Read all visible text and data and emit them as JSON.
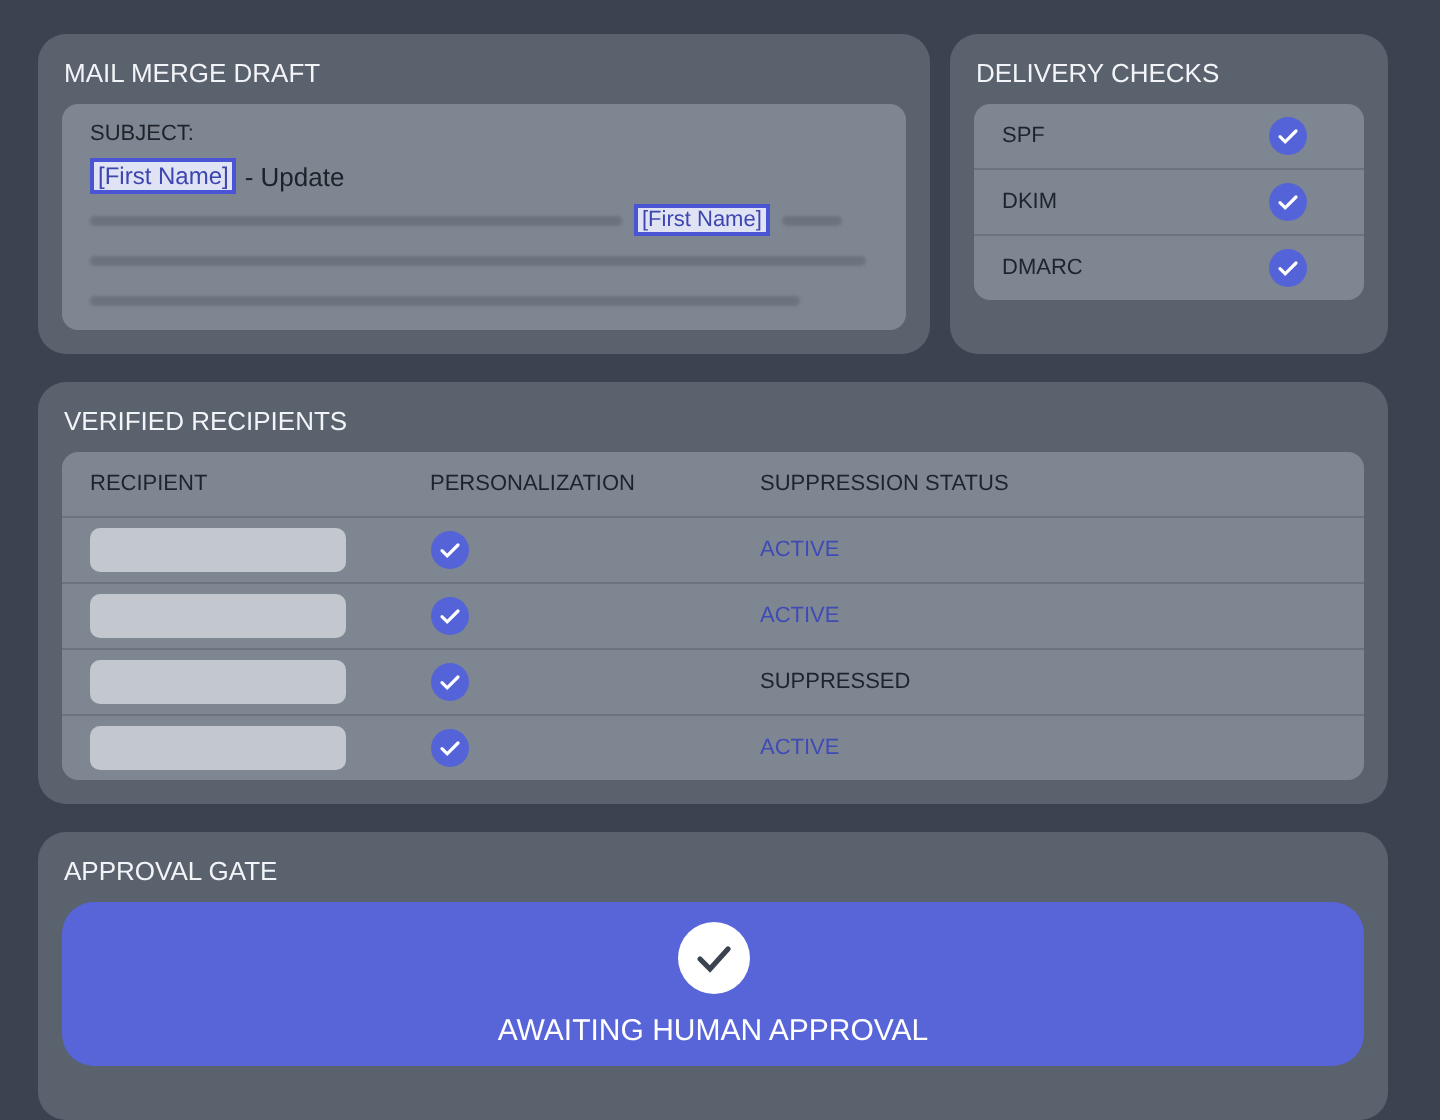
{
  "draft": {
    "title": "MAIL MERGE DRAFT",
    "subject_label": "SUBJECT:",
    "subject_token": "[First Name]",
    "subject_rest": "- Update",
    "body_token": "[First Name]"
  },
  "delivery_checks": {
    "title": "DELIVERY CHECKS",
    "items": [
      {
        "label": "SPF",
        "checked": true
      },
      {
        "label": "DKIM",
        "checked": true
      },
      {
        "label": "DMARC",
        "checked": true
      }
    ]
  },
  "recipients": {
    "title": "VERIFIED RECIPIENTS",
    "columns": [
      "RECIPIENT",
      "PERSONALIZATION",
      "SUPPRESSION STATUS"
    ],
    "rows": [
      {
        "personalized": true,
        "status": "ACTIVE",
        "color": "#3f4bb5"
      },
      {
        "personalized": true,
        "status": "ACTIVE",
        "color": "#3f4bb5"
      },
      {
        "personalized": true,
        "status": "SUPPRESSED",
        "color": "#1f232b"
      },
      {
        "personalized": true,
        "status": "ACTIVE",
        "color": "#3f4bb5"
      }
    ]
  },
  "approval": {
    "title": "APPROVAL GATE",
    "label": "AWAITING HUMAN APPROVAL",
    "approved": true
  }
}
